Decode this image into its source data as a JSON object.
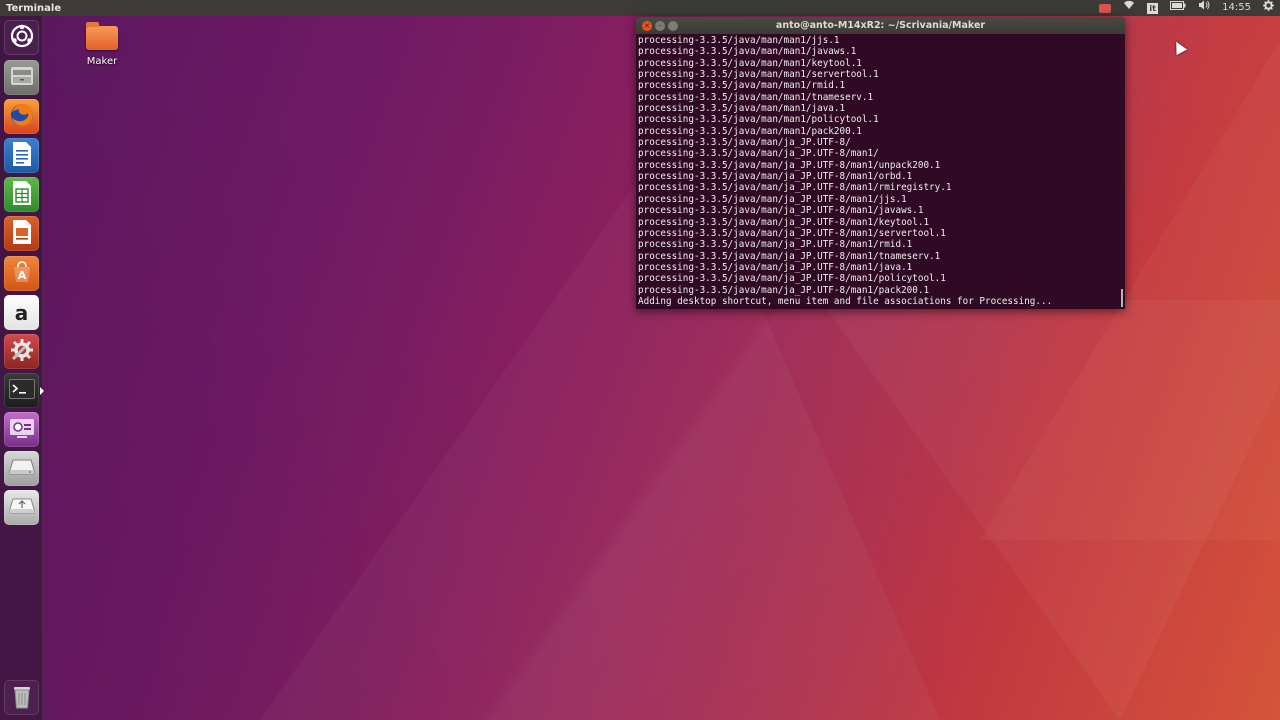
{
  "top_panel": {
    "app_title": "Terminale",
    "clock": "14:55",
    "keyboard_layout": "it"
  },
  "launcher": {
    "items": [
      {
        "name": "dash",
        "icon": "ubuntu-logo-icon"
      },
      {
        "name": "files",
        "icon": "file-cabinet-icon"
      },
      {
        "name": "firefox",
        "icon": "firefox-icon"
      },
      {
        "name": "writer",
        "icon": "libreoffice-writer-icon"
      },
      {
        "name": "calc",
        "icon": "libreoffice-calc-icon"
      },
      {
        "name": "impress",
        "icon": "libreoffice-impress-icon"
      },
      {
        "name": "software",
        "icon": "ubuntu-software-icon"
      },
      {
        "name": "amazon",
        "icon": "amazon-icon",
        "glyph": "a"
      },
      {
        "name": "settings",
        "icon": "system-settings-icon"
      },
      {
        "name": "terminal",
        "icon": "terminal-icon",
        "glyph": ">_"
      },
      {
        "name": "screenshot",
        "icon": "screen-capture-icon"
      },
      {
        "name": "drive-1",
        "icon": "drive-icon"
      },
      {
        "name": "drive-2",
        "icon": "usb-drive-icon"
      },
      {
        "name": "trash",
        "icon": "trash-icon"
      }
    ]
  },
  "desktop": {
    "icons": [
      {
        "label": "Maker",
        "icon": "folder-icon"
      }
    ]
  },
  "terminal": {
    "title": "anto@anto-M14xR2: ~/Scrivania/Maker",
    "lines": [
      "processing-3.3.5/java/man/man1/jjs.1",
      "processing-3.3.5/java/man/man1/javaws.1",
      "processing-3.3.5/java/man/man1/keytool.1",
      "processing-3.3.5/java/man/man1/servertool.1",
      "processing-3.3.5/java/man/man1/rmid.1",
      "processing-3.3.5/java/man/man1/tnameserv.1",
      "processing-3.3.5/java/man/man1/java.1",
      "processing-3.3.5/java/man/man1/policytool.1",
      "processing-3.3.5/java/man/man1/pack200.1",
      "processing-3.3.5/java/man/ja_JP.UTF-8/",
      "processing-3.3.5/java/man/ja_JP.UTF-8/man1/",
      "processing-3.3.5/java/man/ja_JP.UTF-8/man1/unpack200.1",
      "processing-3.3.5/java/man/ja_JP.UTF-8/man1/orbd.1",
      "processing-3.3.5/java/man/ja_JP.UTF-8/man1/rmiregistry.1",
      "processing-3.3.5/java/man/ja_JP.UTF-8/man1/jjs.1",
      "processing-3.3.5/java/man/ja_JP.UTF-8/man1/javaws.1",
      "processing-3.3.5/java/man/ja_JP.UTF-8/man1/keytool.1",
      "processing-3.3.5/java/man/ja_JP.UTF-8/man1/servertool.1",
      "processing-3.3.5/java/man/ja_JP.UTF-8/man1/rmid.1",
      "processing-3.3.5/java/man/ja_JP.UTF-8/man1/tnameserv.1",
      "processing-3.3.5/java/man/ja_JP.UTF-8/man1/java.1",
      "processing-3.3.5/java/man/ja_JP.UTF-8/man1/policytool.1",
      "processing-3.3.5/java/man/ja_JP.UTF-8/man1/pack200.1",
      "Adding desktop shortcut, menu item and file associations for Processing..."
    ]
  },
  "colors": {
    "terminal_bg": "#300a24",
    "panel_bg": "#3c3b37",
    "accent": "#e95420"
  }
}
